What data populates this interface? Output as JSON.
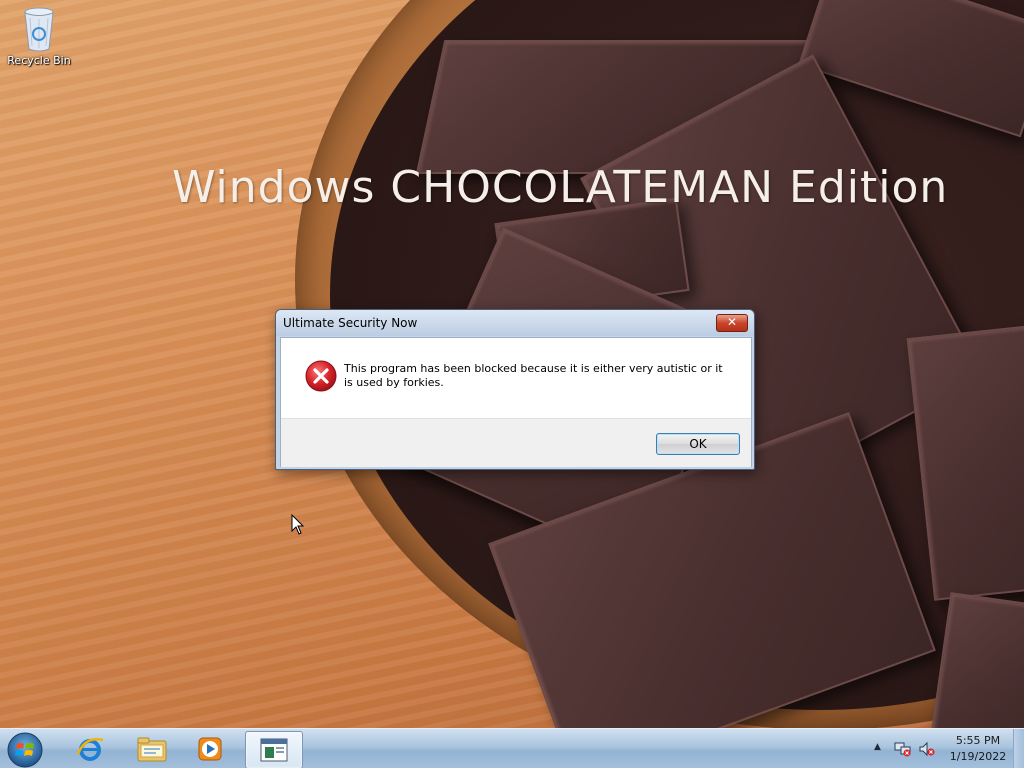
{
  "desktop": {
    "wallpaper_title": "Windows CHOCOLATEMAN Edition",
    "icons": [
      {
        "label": "Recycle Bin",
        "icon": "recycle-bin-icon"
      }
    ]
  },
  "dialog": {
    "title": "Ultimate Security Now",
    "close_label": "✕",
    "icon": "error-icon",
    "message": "This program has been blocked because it is either very autistic or it is used by forkies.",
    "ok_label": "OK"
  },
  "taskbar": {
    "start_icon": "windows-orb-icon",
    "pinned": [
      {
        "name": "internet-explorer-icon"
      },
      {
        "name": "file-explorer-icon"
      },
      {
        "name": "media-player-icon"
      },
      {
        "name": "running-app-window-icon",
        "active": true
      }
    ],
    "tray": {
      "arrow": "▲",
      "network_icon": "network-icon",
      "volume_icon": "volume-muted-icon"
    },
    "clock": {
      "time": "5:55 PM",
      "date": "1/19/2022"
    }
  },
  "colors": {
    "dialog_frame": "#c4d3e6",
    "close_button": "#c9462c",
    "taskbar": "#a9c4de",
    "error_red": "#d8242a"
  }
}
